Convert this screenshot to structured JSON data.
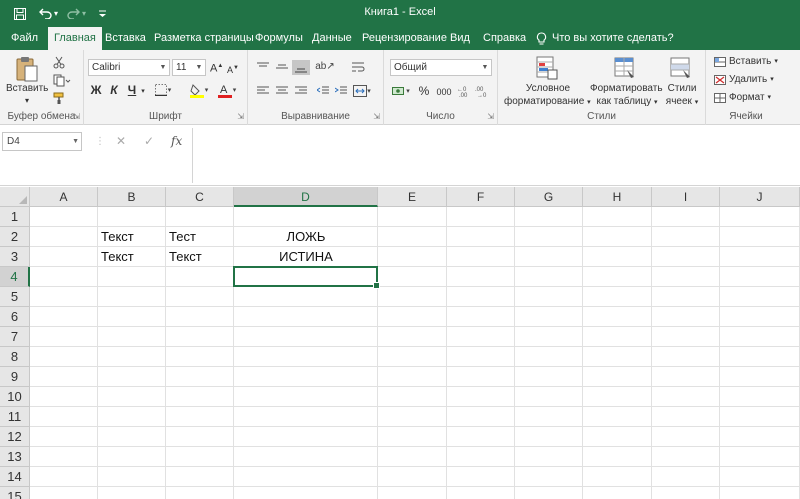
{
  "window": {
    "title": "Книга1  -  Excel"
  },
  "quick_access": [
    {
      "name": "save-icon",
      "glyph": "🖫"
    },
    {
      "name": "undo-icon",
      "glyph": "↶"
    },
    {
      "name": "undo-dropdown-icon",
      "glyph": "▾"
    },
    {
      "name": "redo-icon",
      "glyph": "↷"
    },
    {
      "name": "redo-dropdown-icon",
      "glyph": "▾"
    },
    {
      "name": "customize-qat-icon",
      "glyph": "⩡"
    }
  ],
  "tabs": [
    "Файл",
    "Главная",
    "Вставка",
    "Разметка страницы",
    "Формулы",
    "Данные",
    "Рецензирование",
    "Вид",
    "Справка"
  ],
  "active_tab": "Главная",
  "tell_me": {
    "icon": "lightbulb-icon",
    "placeholder": "Что вы хотите сделать?"
  },
  "ribbon": {
    "clipboard": {
      "label": "Буфер обмена",
      "paste": "Вставить",
      "paste_arrow": "▾"
    },
    "font": {
      "label": "Шрифт",
      "font_name": "Calibri",
      "font_size": "11",
      "bold": "Ж",
      "italic": "К",
      "underline": "Ч",
      "grow": "A",
      "shrink": "A"
    },
    "alignment": {
      "label": "Выравнивание"
    },
    "number": {
      "label": "Число",
      "format": "Общий",
      "percent": "%",
      "comma": "000"
    },
    "styles": {
      "label": "Стили",
      "conditional": [
        "Условное",
        "форматирование"
      ],
      "as_table": [
        "Форматировать",
        "как таблицу"
      ],
      "cell_styles": [
        "Стили",
        "ячеек"
      ]
    },
    "cells": {
      "label": "Ячейки",
      "insert": "Вставить",
      "delete": "Удалить",
      "format": "Формат"
    }
  },
  "formula_bar": {
    "name_box": "D4",
    "cancel": "✕",
    "enter": "✓",
    "fx": "fx",
    "value": ""
  },
  "sheet": {
    "columns": [
      "A",
      "B",
      "C",
      "D",
      "E",
      "F",
      "G",
      "H",
      "I",
      "J"
    ],
    "rows": [
      "1",
      "2",
      "3",
      "4",
      "5",
      "6",
      "7",
      "8",
      "9",
      "10",
      "11",
      "12",
      "13",
      "14",
      "15"
    ],
    "selected_cell": "D4",
    "cells": {
      "B2": "Текст",
      "C2": "Тест",
      "D2": "ЛОЖЬ",
      "B3": "Текст",
      "C3": "Текст",
      "D3": "ИСТИНА"
    }
  }
}
